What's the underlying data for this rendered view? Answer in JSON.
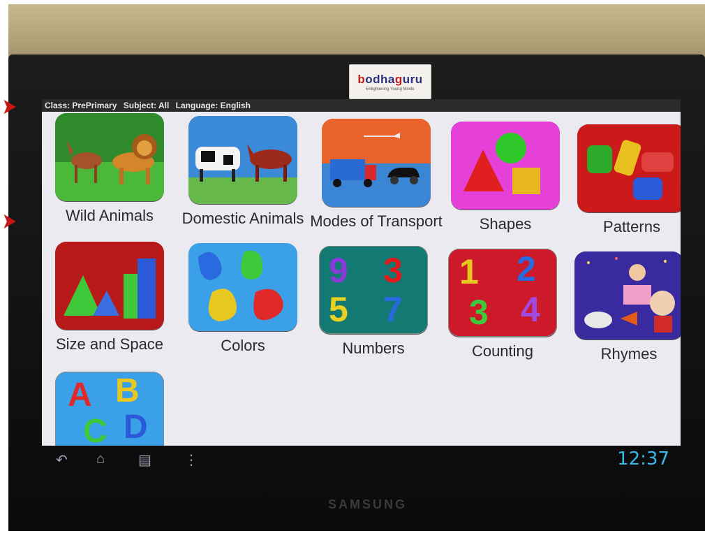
{
  "status": {
    "class_text": "Class: PrePrimary",
    "subject_text": "Subject: All",
    "language_text": "Language: English"
  },
  "brand": {
    "name": "bodhaguru",
    "tagline": "Enlightening Young Minds"
  },
  "tiles": [
    {
      "label": "Wild Animals"
    },
    {
      "label": "Domestic Animals"
    },
    {
      "label": "Modes of Transport"
    },
    {
      "label": "Shapes"
    },
    {
      "label": "Patterns"
    },
    {
      "label": "Size and Space"
    },
    {
      "label": "Colors"
    },
    {
      "label": "Numbers"
    },
    {
      "label": "Counting"
    },
    {
      "label": "Rhymes"
    },
    {
      "label": ""
    }
  ],
  "numbers_tile": [
    "9",
    "3",
    "5",
    "7"
  ],
  "counting_tile": [
    "1",
    "2",
    "3",
    "4"
  ],
  "alphabet_tile": [
    "A",
    "B",
    "C",
    "D"
  ],
  "system": {
    "clock": "12:37"
  },
  "monitor_brand": "SAMSUNG"
}
